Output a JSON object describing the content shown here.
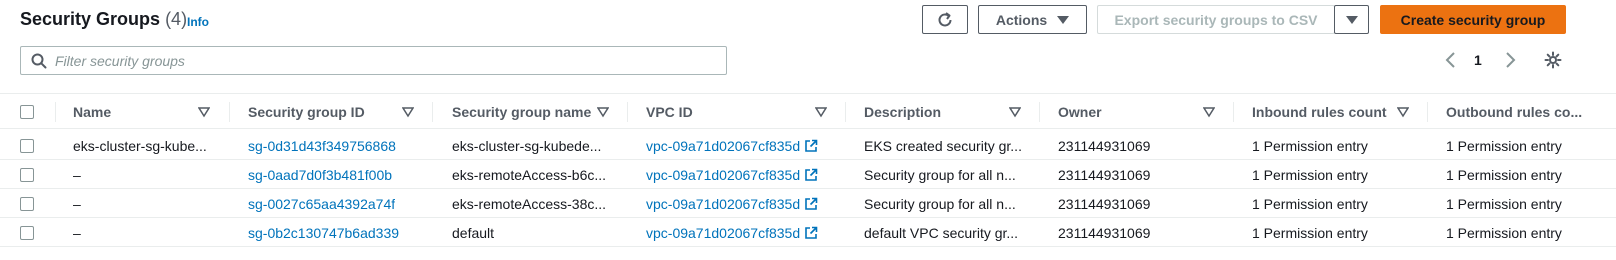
{
  "header": {
    "title": "Security Groups",
    "count": "(4)",
    "info": "Info"
  },
  "toolbar": {
    "refresh_icon": "refresh-icon",
    "actions_label": "Actions",
    "export_label": "Export security groups to CSV",
    "create_label": "Create security group"
  },
  "search": {
    "placeholder": "Filter security groups",
    "value": ""
  },
  "pagination": {
    "current_page": "1"
  },
  "colors": {
    "link": "#0073bb",
    "primary_button": "#ec7211",
    "header_text": "#545b64"
  },
  "table": {
    "columns": [
      "Name",
      "Security group ID",
      "Security group name",
      "VPC ID",
      "Description",
      "Owner",
      "Inbound rules count",
      "Outbound rules co..."
    ],
    "rows": [
      {
        "name": "eks-cluster-sg-kube...",
        "sg_id": "sg-0d31d43f349756868",
        "sg_name": "eks-cluster-sg-kubede...",
        "vpc_id": "vpc-09a71d02067cf835d",
        "description": "EKS created security gr...",
        "owner": "231144931069",
        "inbound": "1 Permission entry",
        "outbound": "1 Permission entry"
      },
      {
        "name": "–",
        "sg_id": "sg-0aad7d0f3b481f00b",
        "sg_name": "eks-remoteAccess-b6c...",
        "vpc_id": "vpc-09a71d02067cf835d",
        "description": "Security group for all n...",
        "owner": "231144931069",
        "inbound": "1 Permission entry",
        "outbound": "1 Permission entry"
      },
      {
        "name": "–",
        "sg_id": "sg-0027c65aa4392a74f",
        "sg_name": "eks-remoteAccess-38c...",
        "vpc_id": "vpc-09a71d02067cf835d",
        "description": "Security group for all n...",
        "owner": "231144931069",
        "inbound": "1 Permission entry",
        "outbound": "1 Permission entry"
      },
      {
        "name": "–",
        "sg_id": "sg-0b2c130747b6ad339",
        "sg_name": "default",
        "vpc_id": "vpc-09a71d02067cf835d",
        "description": "default VPC security gr...",
        "owner": "231144931069",
        "inbound": "1 Permission entry",
        "outbound": "1 Permission entry"
      }
    ]
  }
}
